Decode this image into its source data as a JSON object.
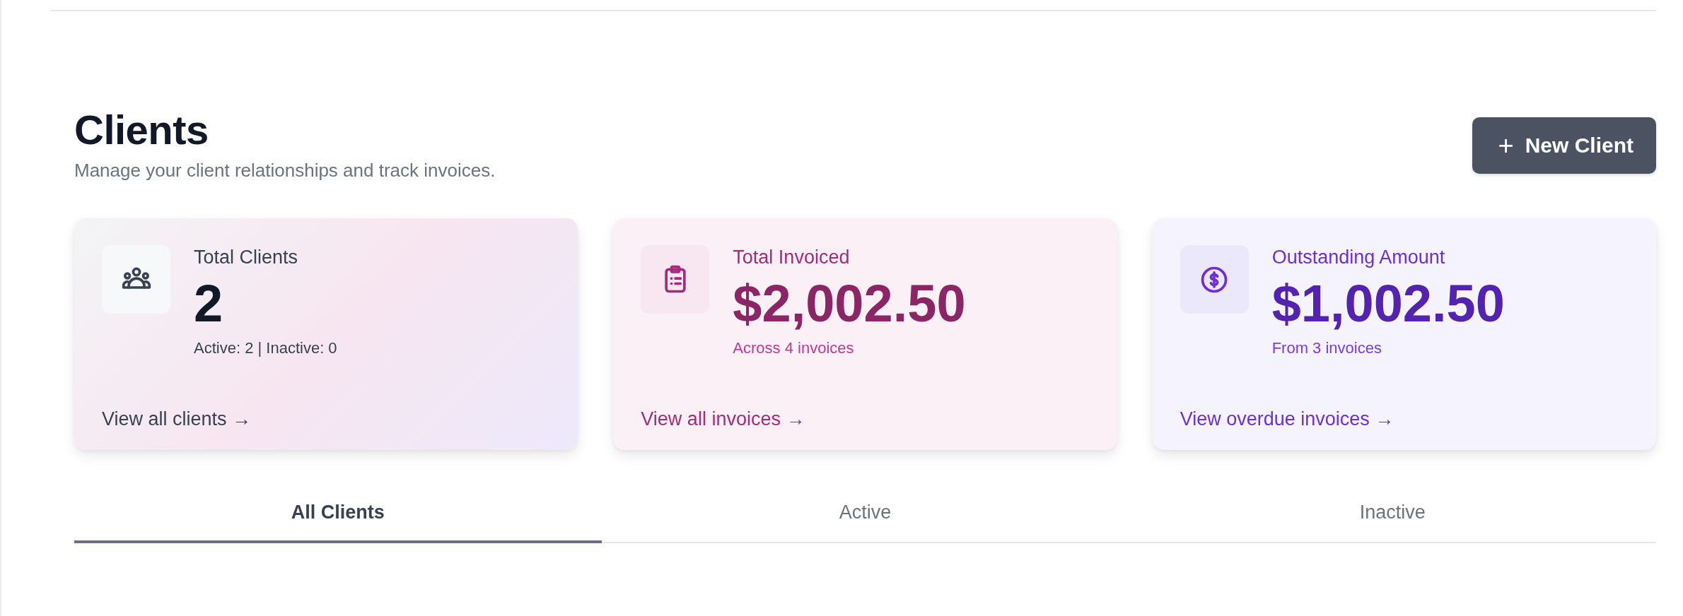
{
  "header": {
    "title": "Clients",
    "subtitle": "Manage your client relationships and track invoices.",
    "new_button": {
      "icon": "+",
      "label": "New Client"
    }
  },
  "cards": [
    {
      "kind": "clients",
      "title": "Total Clients",
      "value": "2",
      "detail": "Active: 2 | Inactive: 0",
      "link": "View all clients →"
    },
    {
      "kind": "invoiced",
      "title": "Total Invoiced",
      "value": "$2,002.50",
      "detail": "Across 4 invoices",
      "link": "View all invoices →"
    },
    {
      "kind": "outstanding",
      "title": "Outstanding Amount",
      "value": "$1,002.50",
      "detail": "From 3 invoices",
      "link": "View overdue invoices →"
    }
  ],
  "tabs": [
    {
      "label": "All Clients",
      "selected": true
    },
    {
      "label": "Active",
      "selected": false
    },
    {
      "label": "Inactive",
      "selected": false
    }
  ]
}
